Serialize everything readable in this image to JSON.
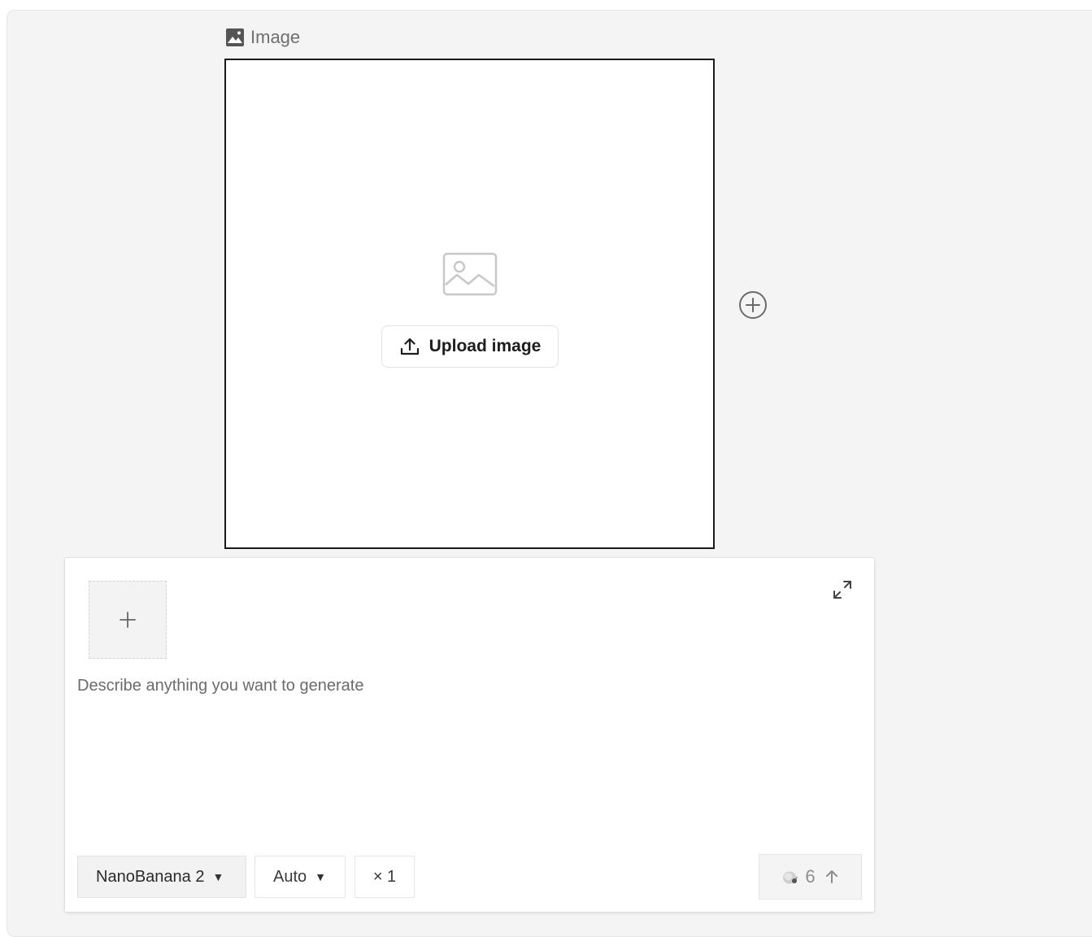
{
  "image_node": {
    "label": "Image",
    "upload_label": "Upload image"
  },
  "prompt": {
    "placeholder": "Describe anything you want to generate",
    "value": ""
  },
  "toolbar": {
    "model": "NanoBanana 2",
    "aspect": "Auto",
    "count": "× 1",
    "credits": "6"
  },
  "icons": {
    "node_label": "image-icon",
    "placeholder": "image-placeholder-icon",
    "upload": "upload-icon",
    "add_node": "plus-circle-icon",
    "add_reference": "plus-icon",
    "expand": "expand-icon",
    "credit": "credit-icon",
    "submit": "arrow-up-icon"
  },
  "colors": {
    "canvas_bg": "#f4f4f4",
    "node_border": "#1a1a1a",
    "panel_bg": "#ffffff",
    "muted_text": "#6b6b6b"
  }
}
